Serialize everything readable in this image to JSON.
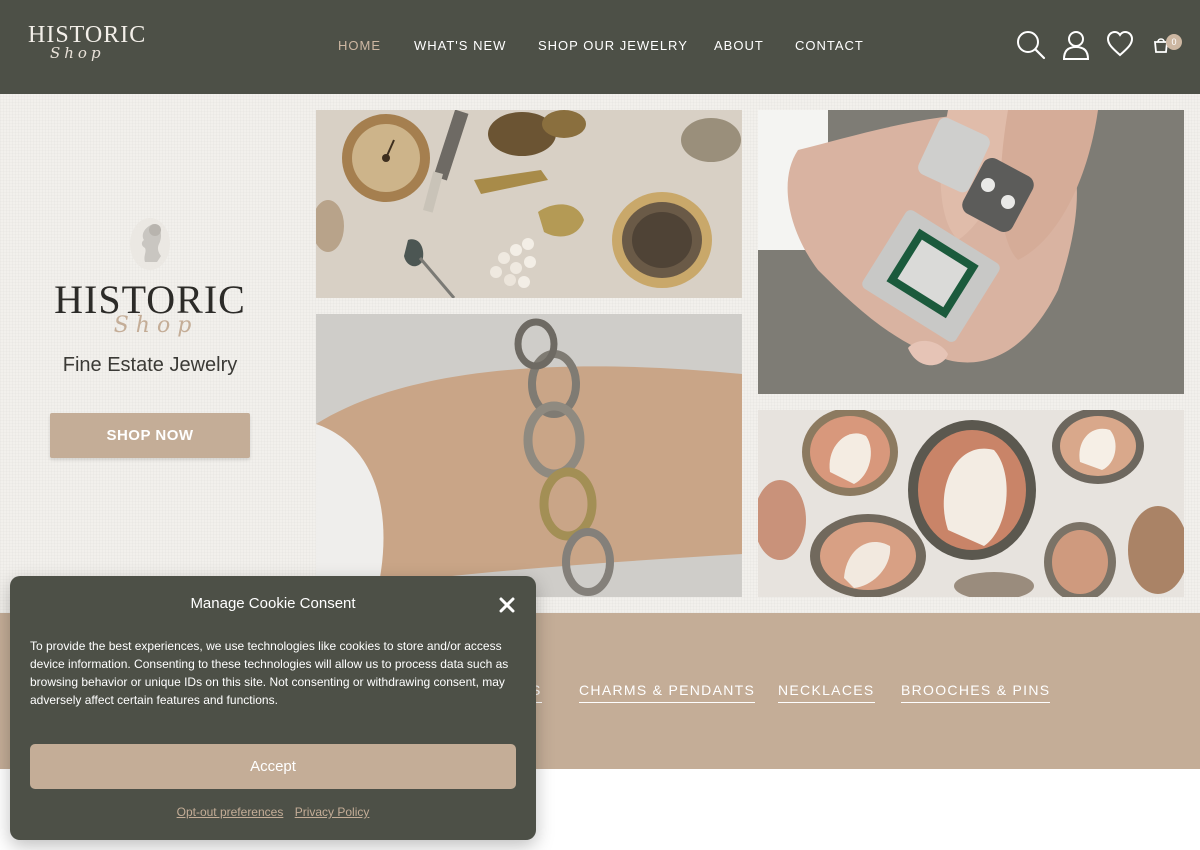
{
  "header": {
    "logo_line1": "HISTORIC",
    "logo_line2": "Shop",
    "nav": [
      "HOME",
      "WHAT'S NEW",
      "SHOP OUR JEWELRY",
      "ABOUT",
      "CONTACT"
    ],
    "active_nav": "HOME",
    "icons": [
      "search-icon",
      "user-icon",
      "heart-icon",
      "cart-icon"
    ],
    "cart_count": "0"
  },
  "hero": {
    "logo_line1": "HISTORIC",
    "logo_line2": "Shop",
    "tagline": "Fine Estate Jewelry",
    "cta": "SHOP NOW",
    "photos": [
      "vintage pocket watch and brooches",
      "hand wearing antique diamond rings",
      "wrist wearing silver and gold link bracelet",
      "collection of shell cameo brooches"
    ]
  },
  "categories": {
    "items": [
      "S",
      "CHARMS & PENDANTS",
      "NECKLACES",
      "BROOCHES & PINS"
    ]
  },
  "cookie": {
    "title": "Manage Cookie Consent",
    "body": "To provide the best experiences, we use technologies like cookies to store and/or access device information. Consenting to these technologies will allow us to process data such as browsing behavior or unique IDs on this site. Not consenting or withdrawing consent, may adversely affect certain features and functions.",
    "accept": "Accept",
    "link_optout": "Opt-out preferences",
    "link_privacy": "Privacy Policy"
  },
  "colors": {
    "header_bg": "#4d5047",
    "accent": "#c4ad97",
    "hero_bg": "#f2f0ec"
  }
}
